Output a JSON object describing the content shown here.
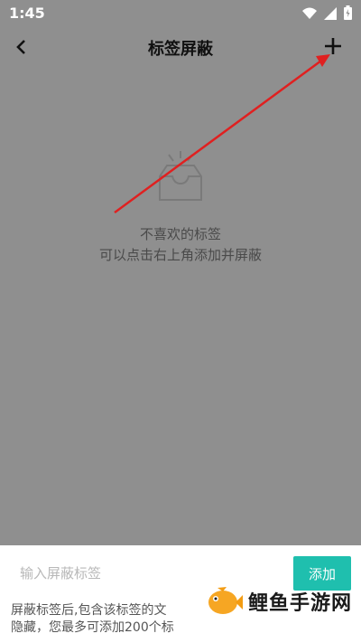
{
  "status_bar": {
    "time": "1:45"
  },
  "nav": {
    "title": "标签屏蔽"
  },
  "empty_state": {
    "line1": "不喜欢的标签",
    "line2": "可以点击右上角添加并屏蔽"
  },
  "bottom_sheet": {
    "input_placeholder": "输入屏蔽标签",
    "add_button": "添加",
    "hint_line1": "屏蔽标签后,包含该标签的文",
    "hint_line2": "隐藏，您最多可添加200个标"
  },
  "watermark": {
    "text": "鲤鱼手游网"
  },
  "colors": {
    "accent": "#1fbfae",
    "annotation_arrow": "#e02020",
    "overlay": "#8f8f8f"
  }
}
